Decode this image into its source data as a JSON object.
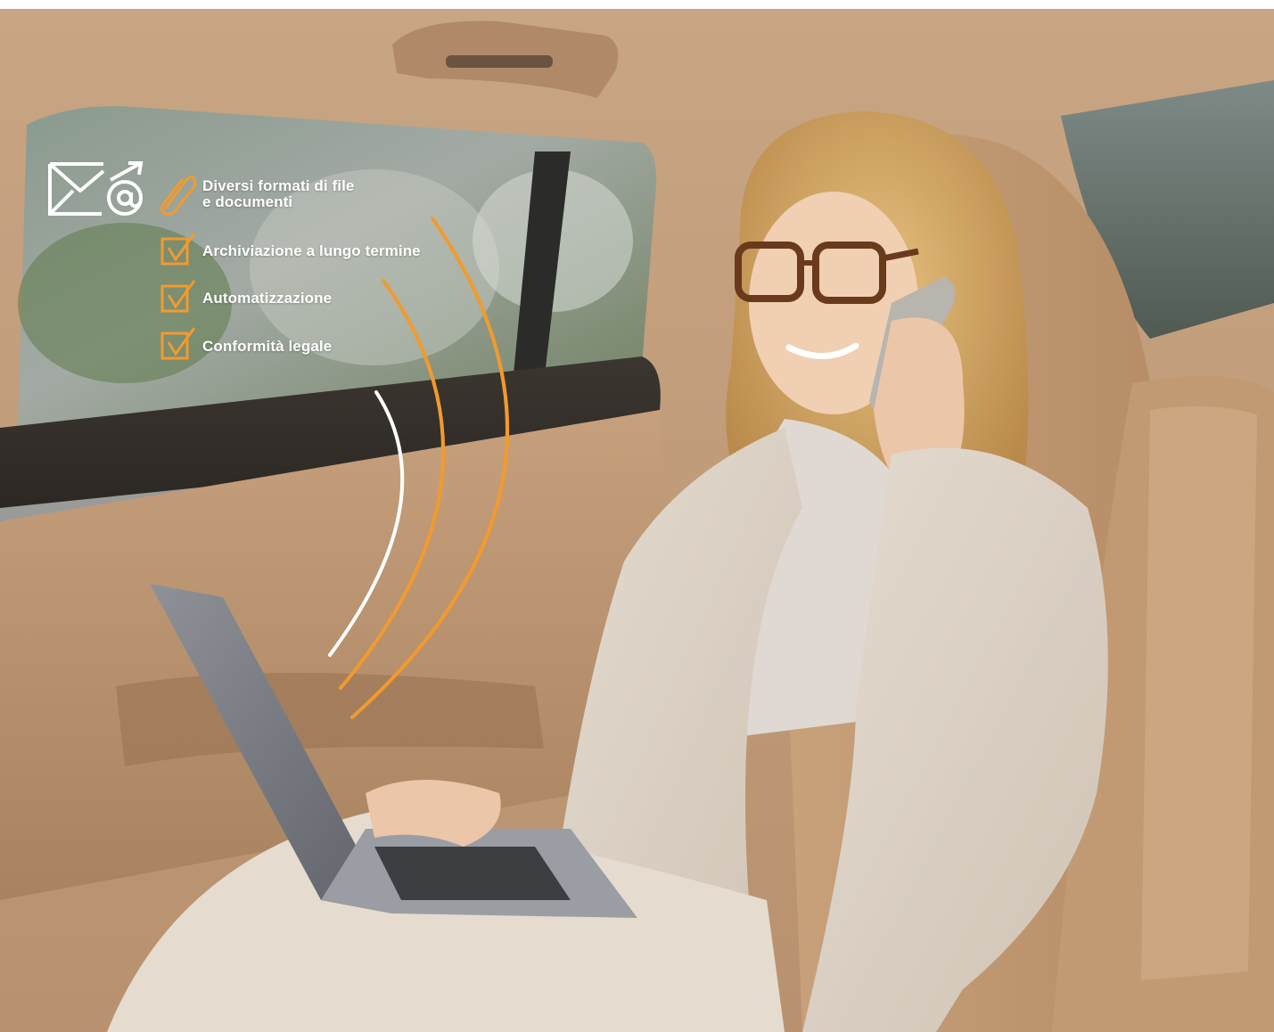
{
  "features": {
    "attachment_line1": "Diversi formati di file",
    "attachment_line2": "e documenti",
    "items": [
      {
        "label": "Archiviazione a lungo termine",
        "icon": "checkbox-check-icon"
      },
      {
        "label": "Automatizzazione",
        "icon": "checkbox-check-icon"
      },
      {
        "label": "Conformità legale",
        "icon": "checkbox-check-icon"
      }
    ]
  },
  "icons": {
    "mail": "envelope-at-icon",
    "attachment": "paperclip-icon"
  },
  "colors": {
    "accent": "#f29a2e",
    "text": "#ffffff",
    "wave_white": "#ffffff"
  }
}
